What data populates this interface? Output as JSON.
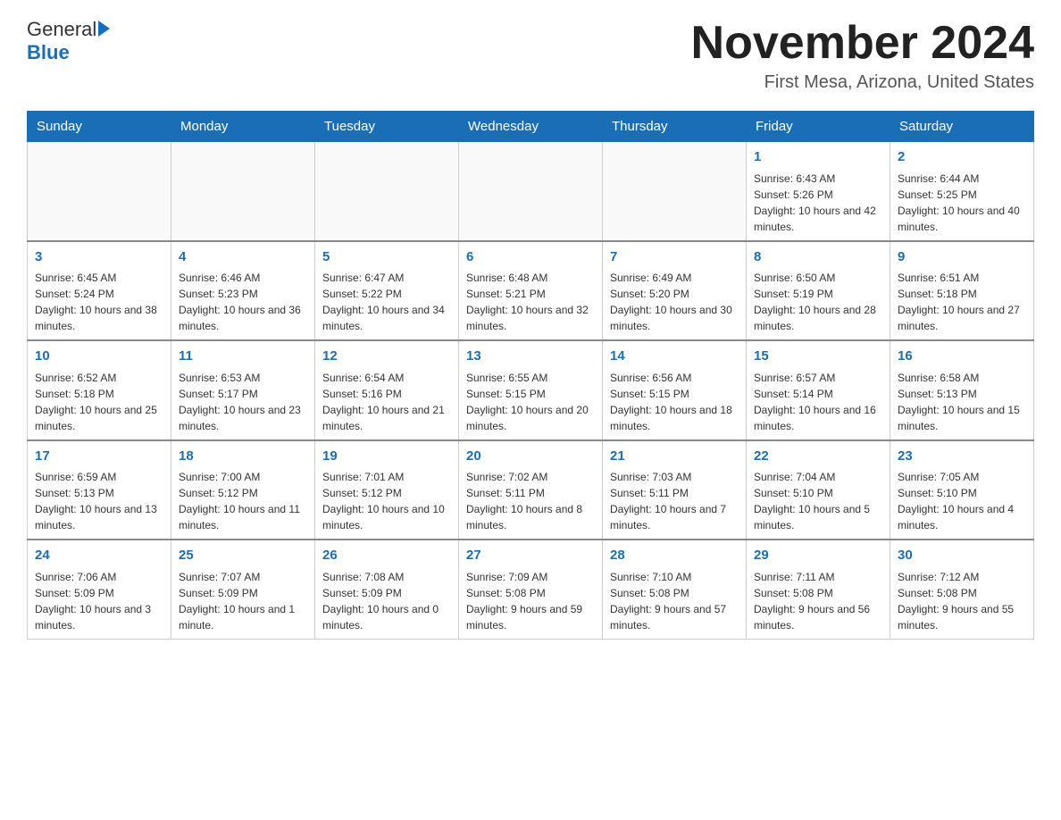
{
  "header": {
    "logo_general": "General",
    "logo_blue": "Blue",
    "month_title": "November 2024",
    "location": "First Mesa, Arizona, United States"
  },
  "days_of_week": [
    "Sunday",
    "Monday",
    "Tuesday",
    "Wednesday",
    "Thursday",
    "Friday",
    "Saturday"
  ],
  "weeks": [
    [
      {
        "day": "",
        "info": ""
      },
      {
        "day": "",
        "info": ""
      },
      {
        "day": "",
        "info": ""
      },
      {
        "day": "",
        "info": ""
      },
      {
        "day": "",
        "info": ""
      },
      {
        "day": "1",
        "info": "Sunrise: 6:43 AM\nSunset: 5:26 PM\nDaylight: 10 hours and 42 minutes."
      },
      {
        "day": "2",
        "info": "Sunrise: 6:44 AM\nSunset: 5:25 PM\nDaylight: 10 hours and 40 minutes."
      }
    ],
    [
      {
        "day": "3",
        "info": "Sunrise: 6:45 AM\nSunset: 5:24 PM\nDaylight: 10 hours and 38 minutes."
      },
      {
        "day": "4",
        "info": "Sunrise: 6:46 AM\nSunset: 5:23 PM\nDaylight: 10 hours and 36 minutes."
      },
      {
        "day": "5",
        "info": "Sunrise: 6:47 AM\nSunset: 5:22 PM\nDaylight: 10 hours and 34 minutes."
      },
      {
        "day": "6",
        "info": "Sunrise: 6:48 AM\nSunset: 5:21 PM\nDaylight: 10 hours and 32 minutes."
      },
      {
        "day": "7",
        "info": "Sunrise: 6:49 AM\nSunset: 5:20 PM\nDaylight: 10 hours and 30 minutes."
      },
      {
        "day": "8",
        "info": "Sunrise: 6:50 AM\nSunset: 5:19 PM\nDaylight: 10 hours and 28 minutes."
      },
      {
        "day": "9",
        "info": "Sunrise: 6:51 AM\nSunset: 5:18 PM\nDaylight: 10 hours and 27 minutes."
      }
    ],
    [
      {
        "day": "10",
        "info": "Sunrise: 6:52 AM\nSunset: 5:18 PM\nDaylight: 10 hours and 25 minutes."
      },
      {
        "day": "11",
        "info": "Sunrise: 6:53 AM\nSunset: 5:17 PM\nDaylight: 10 hours and 23 minutes."
      },
      {
        "day": "12",
        "info": "Sunrise: 6:54 AM\nSunset: 5:16 PM\nDaylight: 10 hours and 21 minutes."
      },
      {
        "day": "13",
        "info": "Sunrise: 6:55 AM\nSunset: 5:15 PM\nDaylight: 10 hours and 20 minutes."
      },
      {
        "day": "14",
        "info": "Sunrise: 6:56 AM\nSunset: 5:15 PM\nDaylight: 10 hours and 18 minutes."
      },
      {
        "day": "15",
        "info": "Sunrise: 6:57 AM\nSunset: 5:14 PM\nDaylight: 10 hours and 16 minutes."
      },
      {
        "day": "16",
        "info": "Sunrise: 6:58 AM\nSunset: 5:13 PM\nDaylight: 10 hours and 15 minutes."
      }
    ],
    [
      {
        "day": "17",
        "info": "Sunrise: 6:59 AM\nSunset: 5:13 PM\nDaylight: 10 hours and 13 minutes."
      },
      {
        "day": "18",
        "info": "Sunrise: 7:00 AM\nSunset: 5:12 PM\nDaylight: 10 hours and 11 minutes."
      },
      {
        "day": "19",
        "info": "Sunrise: 7:01 AM\nSunset: 5:12 PM\nDaylight: 10 hours and 10 minutes."
      },
      {
        "day": "20",
        "info": "Sunrise: 7:02 AM\nSunset: 5:11 PM\nDaylight: 10 hours and 8 minutes."
      },
      {
        "day": "21",
        "info": "Sunrise: 7:03 AM\nSunset: 5:11 PM\nDaylight: 10 hours and 7 minutes."
      },
      {
        "day": "22",
        "info": "Sunrise: 7:04 AM\nSunset: 5:10 PM\nDaylight: 10 hours and 5 minutes."
      },
      {
        "day": "23",
        "info": "Sunrise: 7:05 AM\nSunset: 5:10 PM\nDaylight: 10 hours and 4 minutes."
      }
    ],
    [
      {
        "day": "24",
        "info": "Sunrise: 7:06 AM\nSunset: 5:09 PM\nDaylight: 10 hours and 3 minutes."
      },
      {
        "day": "25",
        "info": "Sunrise: 7:07 AM\nSunset: 5:09 PM\nDaylight: 10 hours and 1 minute."
      },
      {
        "day": "26",
        "info": "Sunrise: 7:08 AM\nSunset: 5:09 PM\nDaylight: 10 hours and 0 minutes."
      },
      {
        "day": "27",
        "info": "Sunrise: 7:09 AM\nSunset: 5:08 PM\nDaylight: 9 hours and 59 minutes."
      },
      {
        "day": "28",
        "info": "Sunrise: 7:10 AM\nSunset: 5:08 PM\nDaylight: 9 hours and 57 minutes."
      },
      {
        "day": "29",
        "info": "Sunrise: 7:11 AM\nSunset: 5:08 PM\nDaylight: 9 hours and 56 minutes."
      },
      {
        "day": "30",
        "info": "Sunrise: 7:12 AM\nSunset: 5:08 PM\nDaylight: 9 hours and 55 minutes."
      }
    ]
  ]
}
